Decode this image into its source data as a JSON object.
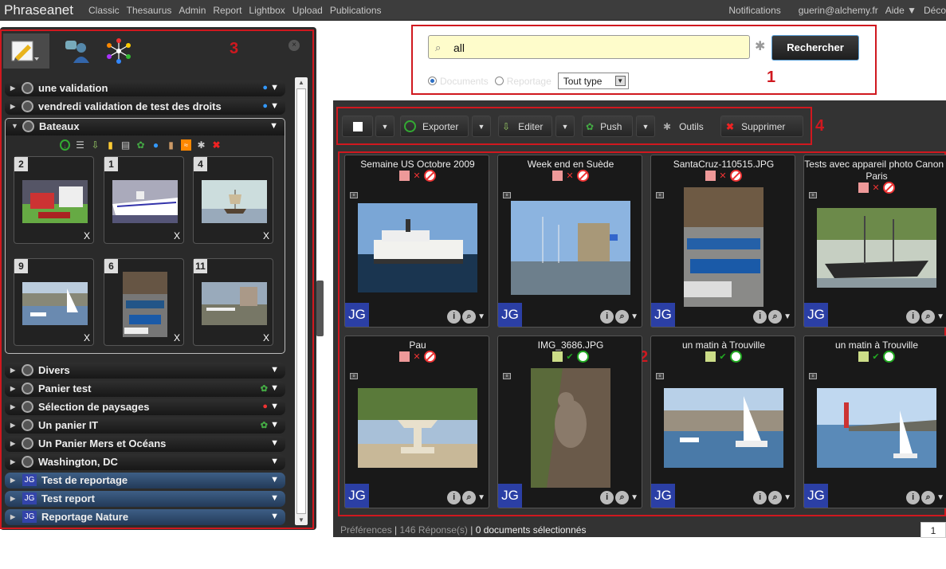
{
  "app": {
    "name": "Phraseanet"
  },
  "menu": [
    "Classic",
    "Thesaurus",
    "Admin",
    "Report",
    "Lightbox",
    "Upload",
    "Publications"
  ],
  "topright": {
    "notifications": "Notifications",
    "user": "guerin@alchemy.fr",
    "help": "Aide ▼",
    "logout": "Déco"
  },
  "annotations": {
    "a1": "1",
    "a2": "2",
    "a3": "3",
    "a4": "4"
  },
  "search": {
    "query": "all",
    "button": "Rechercher",
    "radio_documents": "Documents",
    "radio_reportage": "Reportage",
    "type_select": "Tout type"
  },
  "actions": {
    "exporter": "Exporter",
    "editer": "Editer",
    "push": "Push",
    "outils": "Outils",
    "supprimer": "Supprimer"
  },
  "baskets_top": [
    {
      "label": "une validation"
    },
    {
      "label": "vendredi validation de test des droits"
    }
  ],
  "open_basket": {
    "label": "Bateaux",
    "items": [
      {
        "num": "2"
      },
      {
        "num": "1"
      },
      {
        "num": "4"
      },
      {
        "num": "9"
      },
      {
        "num": "6"
      },
      {
        "num": "11"
      }
    ],
    "remove": "X"
  },
  "baskets_bottom": [
    {
      "label": "Divers"
    },
    {
      "label": "Panier test"
    },
    {
      "label": "Sélection de paysages"
    },
    {
      "label": "Un panier IT"
    },
    {
      "label": "Un Panier Mers et Océans"
    },
    {
      "label": "Washington, DC"
    }
  ],
  "reportages": [
    {
      "badge": "JG",
      "label": "Test de reportage"
    },
    {
      "badge": "JG",
      "label": "Test report"
    },
    {
      "badge": "JG",
      "label": "Reportage Nature"
    }
  ],
  "results": [
    {
      "title": "Semaine US Octobre 2009",
      "status": "refused",
      "jg": "JG"
    },
    {
      "title": "Week end en Suède",
      "status": "refused",
      "jg": "JG"
    },
    {
      "title": "SantaCruz-110515.JPG",
      "status": "refused",
      "jg": "JG"
    },
    {
      "title": "Tests avec appareil photo Canon / Paris",
      "status": "refused",
      "jg": "JG"
    },
    {
      "title": "Pau",
      "status": "refused",
      "jg": "JG"
    },
    {
      "title": "IMG_3686.JPG",
      "status": "accepted",
      "jg": "JG"
    },
    {
      "title": "un matin à Trouville",
      "status": "accepted",
      "jg": "JG"
    },
    {
      "title": "un matin à Trouville",
      "status": "accepted",
      "jg": "JG"
    }
  ],
  "status": {
    "preferences": "Préférences",
    "responses": "146 Réponse(s)",
    "selected": "0 documents sélectionnés",
    "page": "1"
  }
}
